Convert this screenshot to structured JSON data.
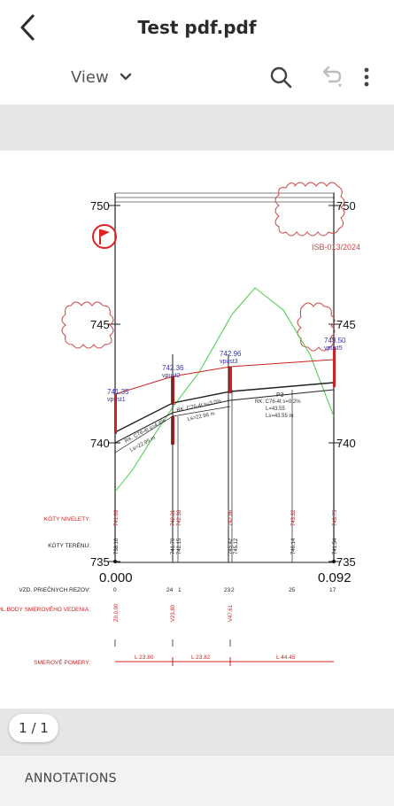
{
  "header": {
    "title": "Test pdf.pdf",
    "view_label": "View"
  },
  "pager": {
    "label": "1 / 1"
  },
  "annotations": {
    "label": "ANNOTATIONS"
  },
  "drawing": {
    "y_labels": [
      "750",
      "745",
      "740",
      "735"
    ],
    "y_labels_right": [
      "750",
      "745",
      "740",
      "735"
    ],
    "station_start": "0.000",
    "station_end": "0.092",
    "row_labels": [
      "KÓTY NIVELETY:",
      "KÓTY TERÉNU:",
      "VZD. PRIEČNYCH REZOV:",
      "HL.BODY SMEROVÉHO VEDENIA:",
      "SMEROVÉ POMERY:"
    ],
    "elevation_labels": [
      "741.35",
      "742.36",
      "742.96",
      "743.50"
    ],
    "well_labels": [
      "vpust1",
      "vpust2",
      "vpust3",
      "vpust5"
    ],
    "segment_labels": [
      "L 23.80",
      "L 23.82",
      "L 44.45"
    ],
    "cloud_text": "ISB-013/2024",
    "niveleta_values": [
      "741.09",
      "742.31",
      "742.36",
      "742.86",
      "743.32",
      "743.75"
    ],
    "teren_values": [
      "738.16",
      "741.79",
      "742.15",
      "745.42",
      "745.12",
      "746.14",
      "741.54"
    ],
    "distance_values": [
      "0",
      "24",
      "1",
      "23",
      "2",
      "25",
      "17"
    ],
    "main_points": [
      "Z0.0.00",
      "V23.80",
      "V47.61"
    ],
    "slope_notes": [
      "RK. C76-4t s=4.4%",
      "Ls=22.95 m",
      "RK. C76-4t s=3.0%",
      "Ls=22.96 m",
      "P3",
      "RK. C76-4t s=0.2%",
      "L=43.55",
      "Ls=43.55 m"
    ]
  }
}
